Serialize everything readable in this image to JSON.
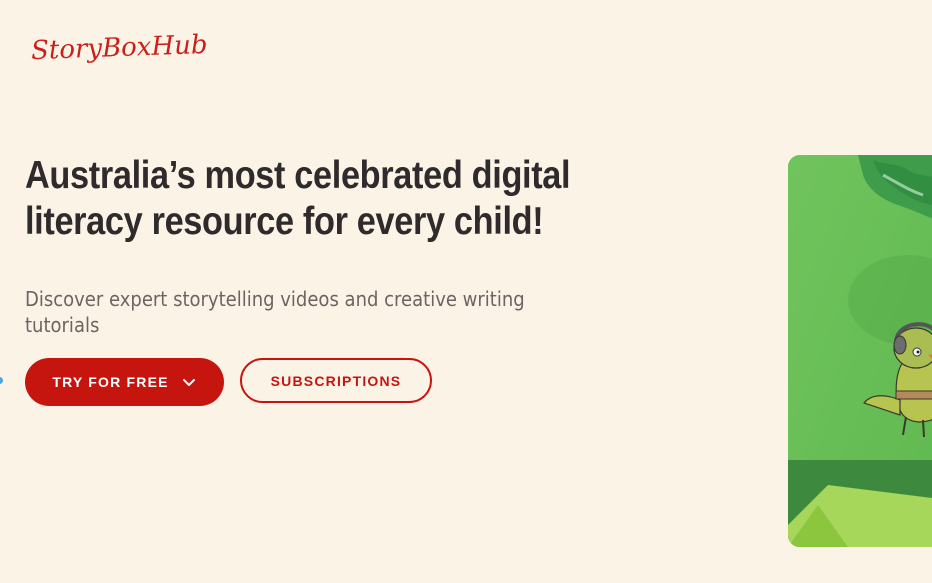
{
  "brand": {
    "logo_text": "StoryBoxHub",
    "accent_color": "#c6150f",
    "background_color": "#fcf3e7"
  },
  "hero": {
    "headline_line1": "Australia’s most celebrated digital",
    "headline_line2": "literacy resource for every child!",
    "subheadline": "Discover expert storytelling videos and creative writing tutorials",
    "primary_button": {
      "label": "TRY FOR FREE",
      "icon": "chevron-down-icon"
    },
    "secondary_button": {
      "label": "SUBSCRIPTIONS"
    },
    "image": {
      "subject": "cartoon lizard with headphones on green background"
    }
  }
}
